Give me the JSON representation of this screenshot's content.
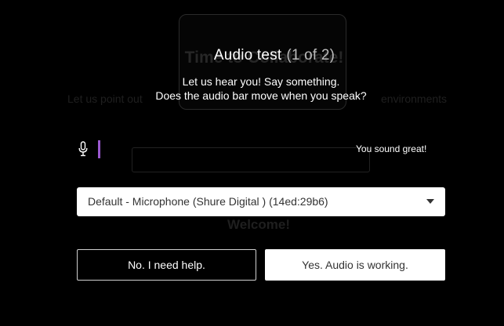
{
  "background": {
    "heading": "Time to Collaborate!",
    "subtitle_left": "Let us point out",
    "subtitle_right": "environments",
    "welcome": "Welcome!"
  },
  "modal": {
    "title": "Audio test",
    "step": "(1 of 2)",
    "prompt_1": "Let us hear you! Say something.",
    "prompt_2": "Does the audio bar move when you speak?",
    "status": "You sound great!",
    "icon": "microphone-icon",
    "audio_level": 0.0,
    "microphone": {
      "selected": "Default - Microphone (Shure Digital ) (14ed:29b6)"
    },
    "buttons": {
      "no": "No. I need help.",
      "yes": "Yes. Audio is working."
    }
  },
  "colors": {
    "background": "#000000",
    "audio_bar": "#9b59d0",
    "text": "#ffffff"
  }
}
